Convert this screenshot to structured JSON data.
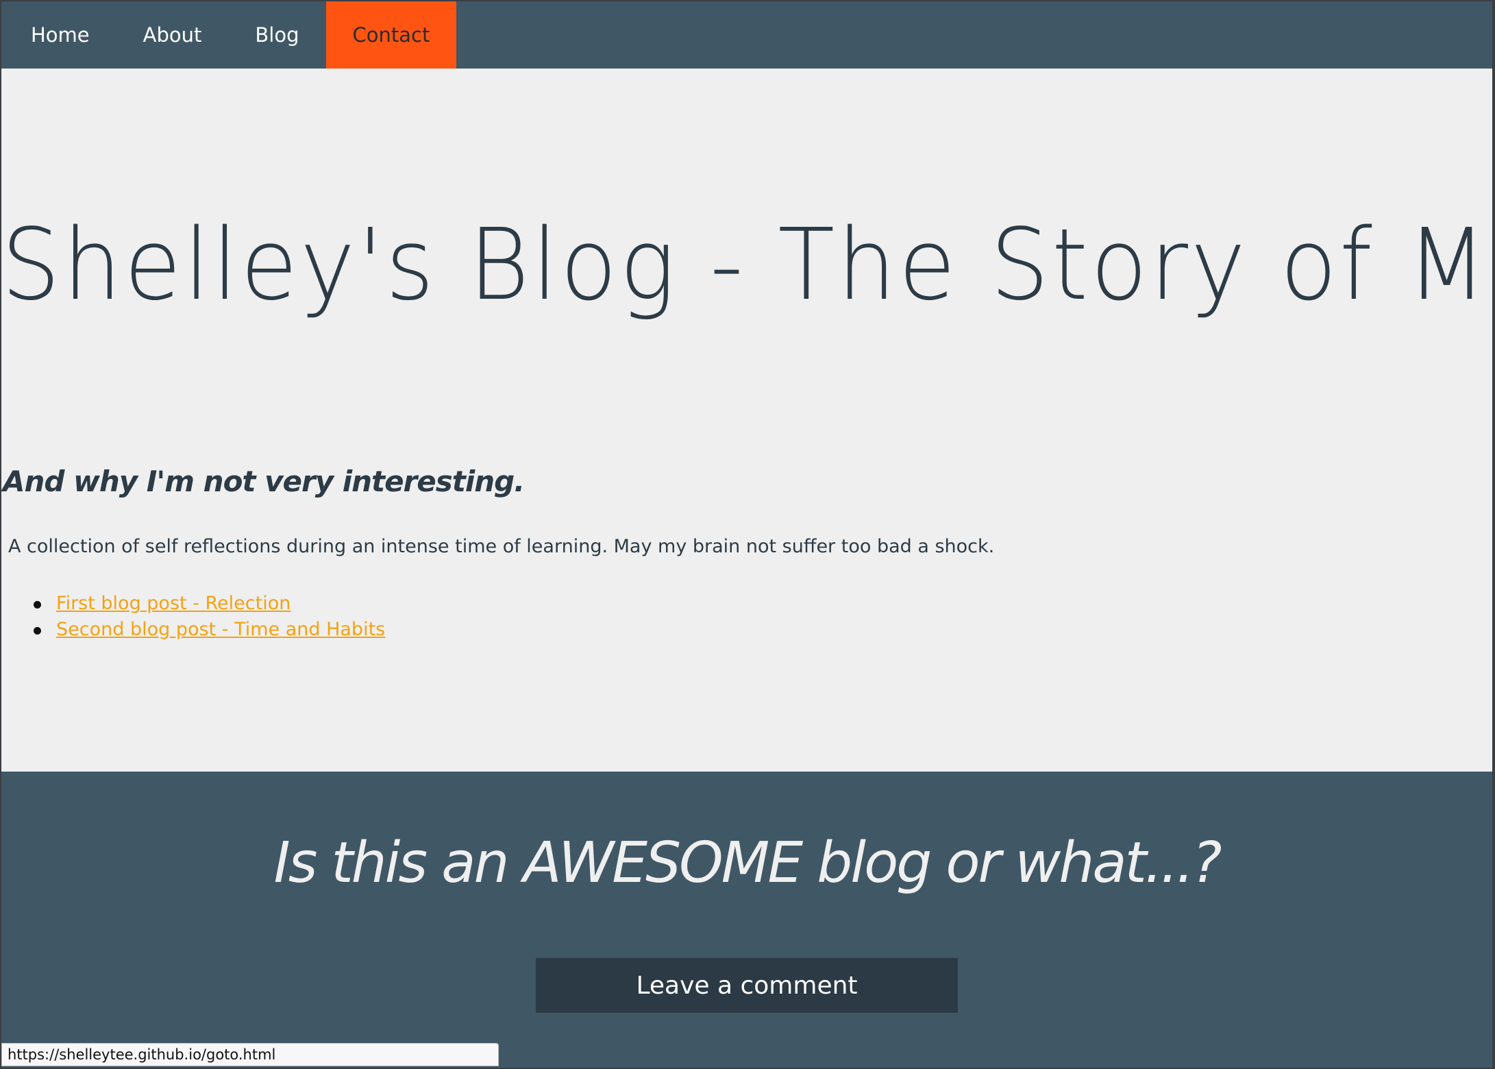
{
  "nav": {
    "items": [
      {
        "label": "Home"
      },
      {
        "label": "About"
      },
      {
        "label": "Blog"
      },
      {
        "label": "Contact"
      }
    ],
    "active": "Contact"
  },
  "header": {
    "title": "Shelley's Blog - The Story of ME",
    "subtitle": "And why I'm not very interesting."
  },
  "main": {
    "intro": "A collection of self reflections during an intense time of learning. May my brain not suffer too bad a shock.",
    "posts": [
      {
        "label": "First blog post - Relection"
      },
      {
        "label": "Second blog post - Time and Habits"
      }
    ]
  },
  "footer": {
    "heading": "Is this an AWESOME blog or what...?",
    "button_label": "Leave a comment"
  },
  "status_bar": {
    "url": "https://shelleytee.github.io/goto.html"
  },
  "colors": {
    "nav_bg": "#405766",
    "nav_active": "#ff5412",
    "page_bg": "#efefef",
    "text": "#2c3b46",
    "link": "#f4a213",
    "button_bg": "#2b3a45"
  }
}
